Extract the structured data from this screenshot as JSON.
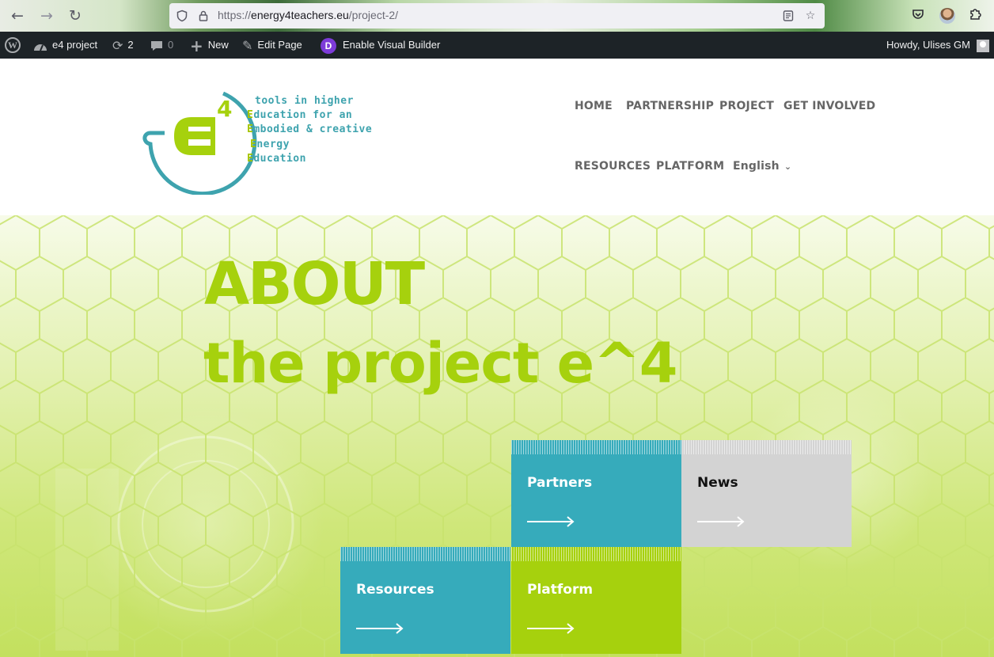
{
  "browser": {
    "url_prefix": "https://",
    "url_domain": "energy4teachers.eu",
    "url_path": "/project-2/"
  },
  "adminbar": {
    "site_name": "e4 project",
    "updates_count": "2",
    "comments_count": "0",
    "new_label": "New",
    "edit_page_label": "Edit Page",
    "visual_builder_label": "Enable Visual Builder",
    "visual_builder_badge": "D",
    "howdy_label": "Howdy, Ulises GM"
  },
  "logo": {
    "line1": "tools in higher",
    "line2_cap": "E",
    "line2_rest": "ducation for an",
    "line3_cap": "E",
    "line3_rest": "mbodied & creative",
    "line4_cap": "E",
    "line4_rest": "nergy",
    "line5_cap": "E",
    "line5_rest": "ducation",
    "brand_colors": {
      "teal": "#3ea3ae",
      "green": "#a6c400"
    }
  },
  "menu": {
    "home": "HOME",
    "partnership": "PARTNERSHIP",
    "project": "PROJECT",
    "get_involved": "GET INVOLVED",
    "resources": "RESOURCES",
    "platform": "PLATFORM",
    "language": "English"
  },
  "hero": {
    "title_line1": "ABOUT",
    "title_line2": "the project e^4"
  },
  "tiles": {
    "partners": {
      "label": "Partners",
      "color": "#36abbb"
    },
    "news": {
      "label": "News",
      "color": "#d3d3d3"
    },
    "resources": {
      "label": "Resources",
      "color": "#36abbb"
    },
    "platform": {
      "label": "Platform",
      "color": "#a6d10d"
    }
  }
}
